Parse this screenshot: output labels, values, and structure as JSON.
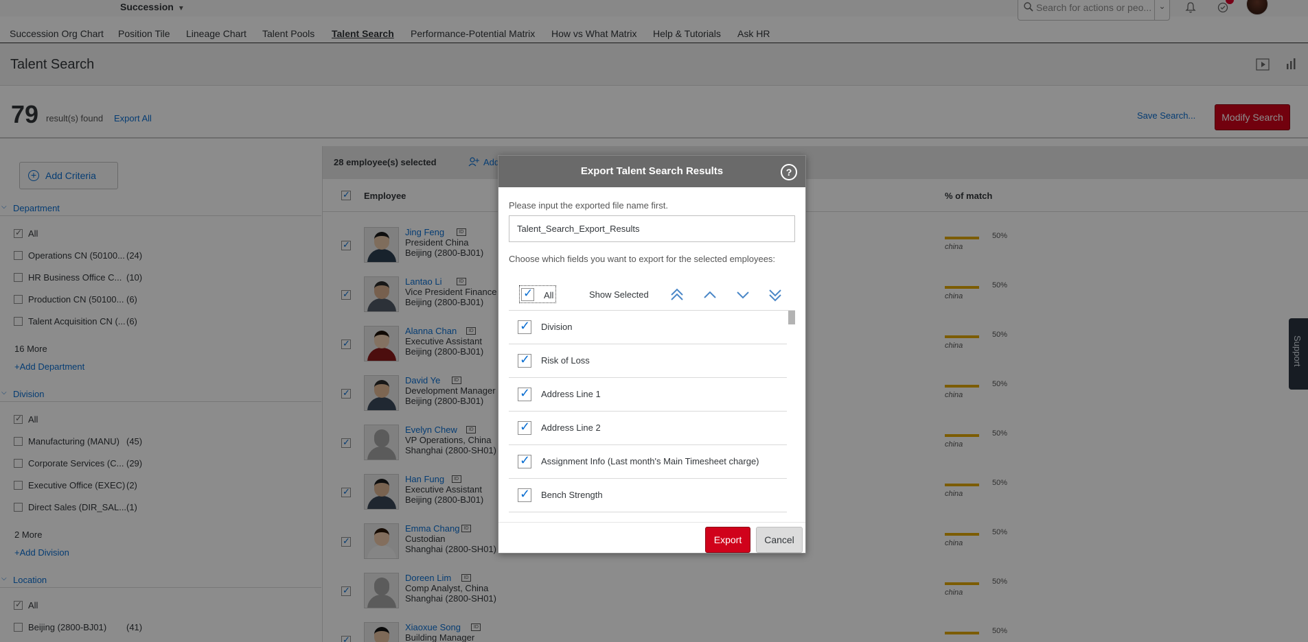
{
  "header": {
    "app_title": "Succession",
    "search_placeholder": "Search for actions or peo...",
    "notification_icon": "bell-icon",
    "todo_icon": "todo-icon"
  },
  "nav": {
    "items": [
      {
        "label": "Succession Org Chart"
      },
      {
        "label": "Position Tile"
      },
      {
        "label": "Lineage Chart"
      },
      {
        "label": "Talent Pools"
      },
      {
        "label": "Talent Search",
        "active": true
      },
      {
        "label": "Performance-Potential Matrix"
      },
      {
        "label": "How vs What Matrix"
      },
      {
        "label": "Help & Tutorials"
      },
      {
        "label": "Ask HR"
      }
    ]
  },
  "page": {
    "title": "Talent Search",
    "result_count": "79",
    "results_label": "result(s) found",
    "export_all": "Export All",
    "save_search": "Save Search...",
    "modify_search": "Modify Search"
  },
  "filters": {
    "add_criteria": "Add Criteria",
    "department": {
      "title": "Department",
      "items": [
        {
          "label": "All",
          "count": ""
        },
        {
          "label": "Operations CN (50100...",
          "count": "(24)"
        },
        {
          "label": "HR Business Office C...",
          "count": "(10)"
        },
        {
          "label": "Production CN (50100...",
          "count": "(6)"
        },
        {
          "label": "Talent Acquisition CN (...",
          "count": "(6)"
        }
      ],
      "more": "16 More",
      "add": "+Add Department"
    },
    "division": {
      "title": "Division",
      "items": [
        {
          "label": "All",
          "count": ""
        },
        {
          "label": "Manufacturing (MANU)",
          "count": "(45)"
        },
        {
          "label": "Corporate Services (C...",
          "count": "(29)"
        },
        {
          "label": "Executive Office (EXEC)",
          "count": "(2)"
        },
        {
          "label": "Direct Sales (DIR_SAL...",
          "count": "(1)"
        }
      ],
      "more": "2 More",
      "add": "+Add Division"
    },
    "location": {
      "title": "Location",
      "items": [
        {
          "label": "All",
          "count": ""
        },
        {
          "label": "Beijing (2800-BJ01)",
          "count": "(41)"
        }
      ]
    }
  },
  "list": {
    "selected_text": "28 employee(s) selected",
    "add_label": "Add",
    "col_employee": "Employee",
    "col_match": "% of match",
    "rows": [
      {
        "name": "Jing Feng",
        "title": "President China",
        "location": "Beijing (2800-BJ01)",
        "match": "50%",
        "country": "china",
        "match_value": 0.5
      },
      {
        "name": "Lantao Li",
        "title": "Vice President Finance",
        "location": "Beijing (2800-BJ01)",
        "match": "50%",
        "country": "china",
        "match_value": 0.5
      },
      {
        "name": "Alanna Chan",
        "title": "Executive Assistant",
        "location": "Beijing (2800-BJ01)",
        "match": "50%",
        "country": "china",
        "match_value": 0.5
      },
      {
        "name": "David Ye",
        "title": "Development Manager",
        "location": "Beijing (2800-BJ01)",
        "match": "50%",
        "country": "china",
        "match_value": 0.5
      },
      {
        "name": "Evelyn Chew",
        "title": "VP Operations, China",
        "location": "Shanghai (2800-SH01)",
        "match": "50%",
        "country": "china",
        "match_value": 0.5
      },
      {
        "name": "Han Fung",
        "title": "Executive Assistant",
        "location": "Beijing (2800-BJ01)",
        "match": "50%",
        "country": "china",
        "match_value": 0.5
      },
      {
        "name": "Emma Chang",
        "title": "Custodian",
        "location": "Shanghai (2800-SH01)",
        "match": "50%",
        "country": "china",
        "match_value": 0.5
      },
      {
        "name": "Doreen Lim",
        "title": "Comp Analyst, China",
        "location": "Shanghai (2800-SH01)",
        "match": "50%",
        "country": "china",
        "match_value": 0.5
      },
      {
        "name": "Xiaoxue Song",
        "title": "Building Manager",
        "location": "",
        "match": "50%",
        "country": "",
        "match_value": 0.5
      }
    ]
  },
  "dialog": {
    "title": "Export Talent Search Results",
    "help": "?",
    "file_label": "Please input the exported file name first.",
    "file_value": "Talent_Search_Export_Results",
    "fields_label": "Choose which fields you want to export for the selected employees:",
    "all_label": "All",
    "show_selected": "Show Selected",
    "fields": [
      {
        "label": "Division",
        "checked": true
      },
      {
        "label": "Risk of Loss",
        "checked": true
      },
      {
        "label": "Address Line 1",
        "checked": true
      },
      {
        "label": "Address Line 2",
        "checked": true
      },
      {
        "label": "Assignment Info (Last month's Main Timesheet charge)",
        "checked": true
      },
      {
        "label": "Bench Strength",
        "checked": true
      }
    ],
    "export": "Export",
    "cancel": "Cancel"
  },
  "support": "Support",
  "colors": {
    "accent": "#0a6ed1",
    "primary_button": "#d0021b",
    "match_bar": "#e2a800"
  }
}
